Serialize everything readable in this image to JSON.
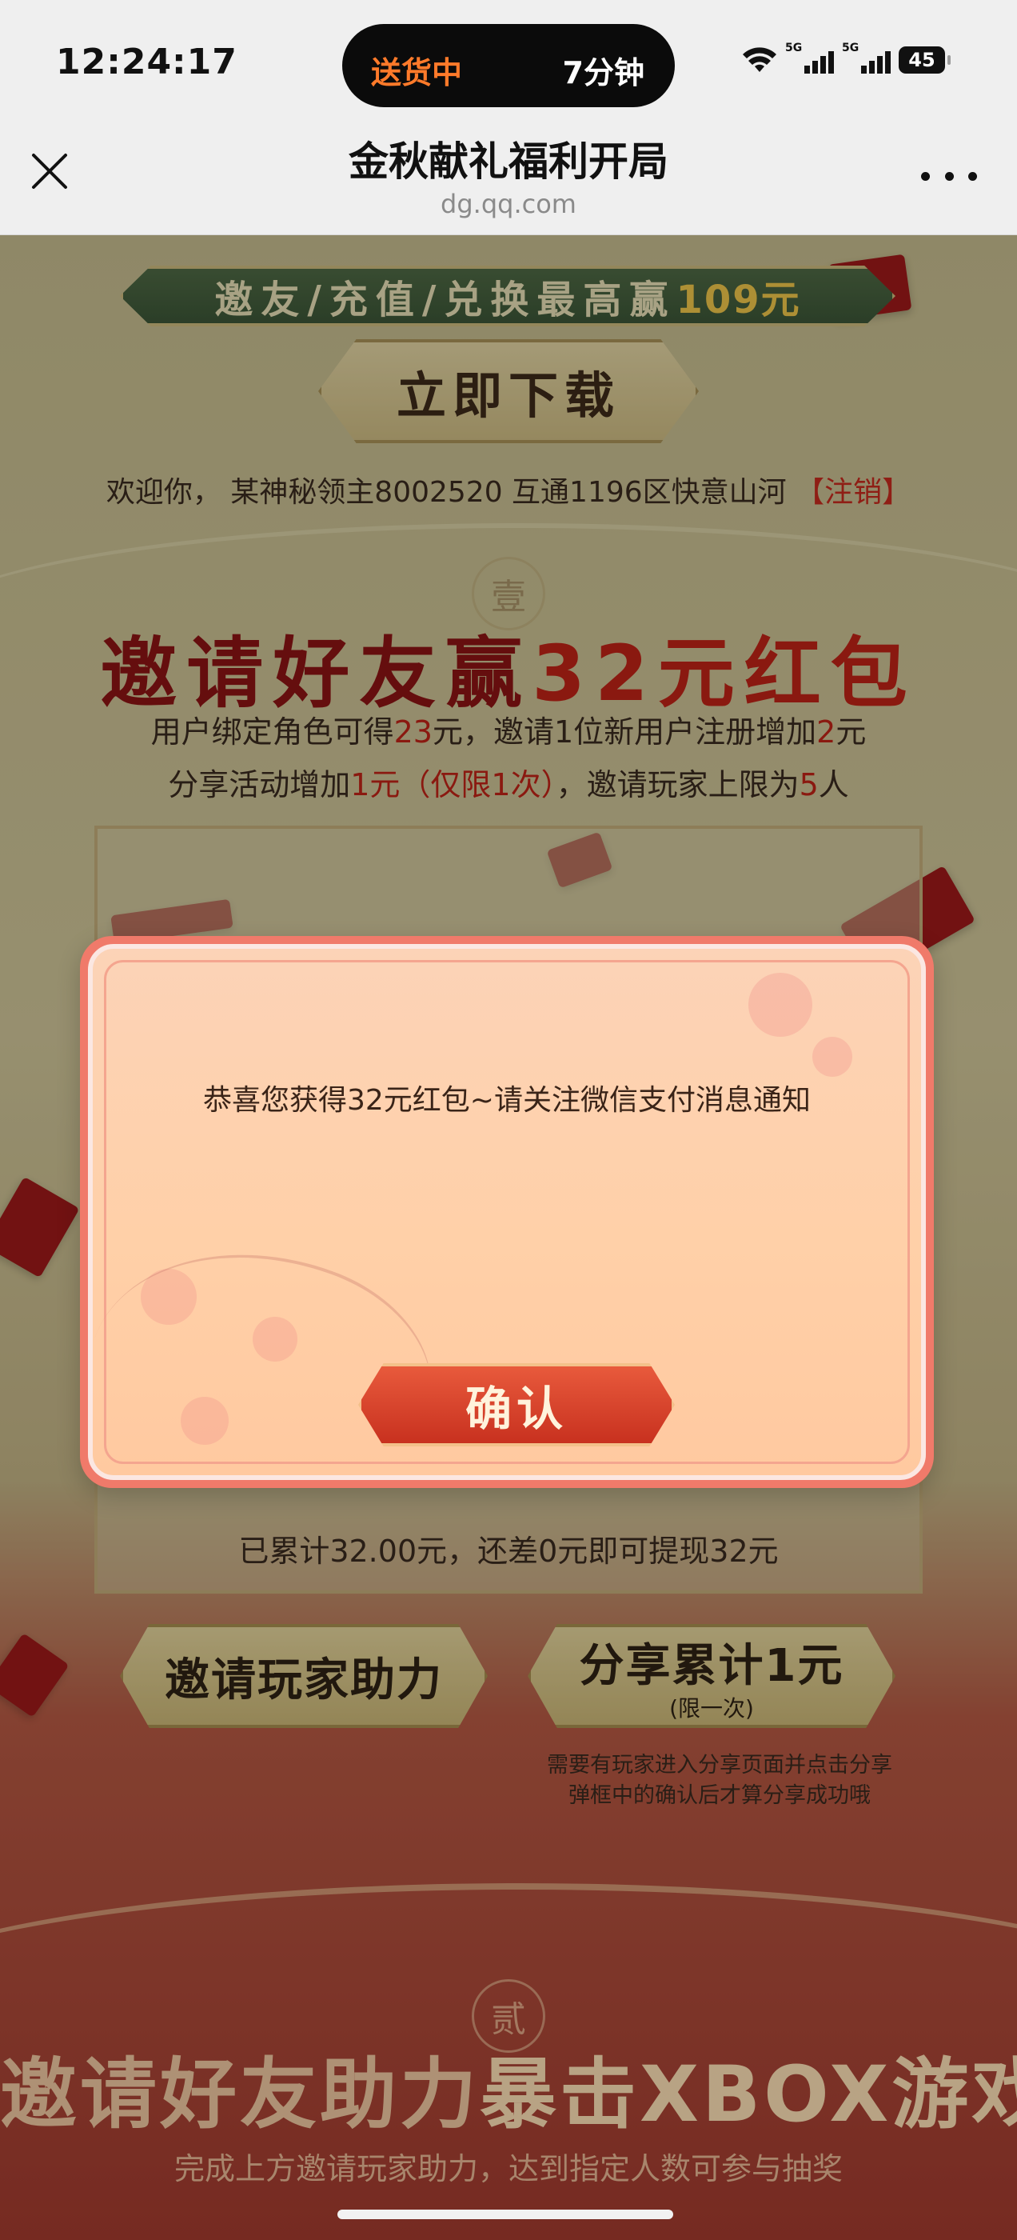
{
  "status_bar": {
    "time": "12:24:17",
    "island_left": "送货中",
    "island_right": "7分钟",
    "signal_tag_1": "5G",
    "signal_tag_2": "5G",
    "battery": "45"
  },
  "nav": {
    "title": "金秋献礼福利开局",
    "url": "dg.qq.com"
  },
  "page": {
    "banner": {
      "text": "邀友/充值/兑换最高赢",
      "amount": "109元"
    },
    "download_button": "立即下载",
    "welcome": {
      "text": "欢迎你， 某神秘领主8002520 互通1196区快意山河 ",
      "logout": "【注销】"
    },
    "seal_1": "壹",
    "invite_title": {
      "text": "邀请好友赢",
      "amount": "32元红包"
    },
    "desc_line1": {
      "a": "用户绑定角色可得",
      "b": "23",
      "c": "元，邀请1位新用户注册增加",
      "d": "2",
      "e": "元"
    },
    "desc_line2": {
      "a": "分享活动增加",
      "b": "1元（仅限1次）",
      "c": "，邀请玩家上限为",
      "d": "5",
      "e": "人"
    },
    "progress_text": "已累计32.00元，还差0元即可提现32元",
    "invite_help_button": "邀请玩家助力",
    "share_button": {
      "title": "分享累计1元",
      "subtitle": "(限一次)"
    },
    "share_note_line1": "需要有玩家进入分享页面并点击分享",
    "share_note_line2": "弹框中的确认后才算分享成功哦",
    "seal_2": "贰",
    "xbox_title": {
      "a": "邀请好友助力",
      "b": "暴击XBOX游戏机"
    },
    "xbox_subtitle": "完成上方邀请玩家助力，达到指定人数可参与抽奖"
  },
  "modal": {
    "message": "恭喜您获得32元红包~请关注微信支付消息通知",
    "confirm_label": "确认"
  },
  "colors": {
    "accent_red": "#c02317",
    "island_orange": "#ff7a2a",
    "modal_border": "#f07a6a"
  }
}
